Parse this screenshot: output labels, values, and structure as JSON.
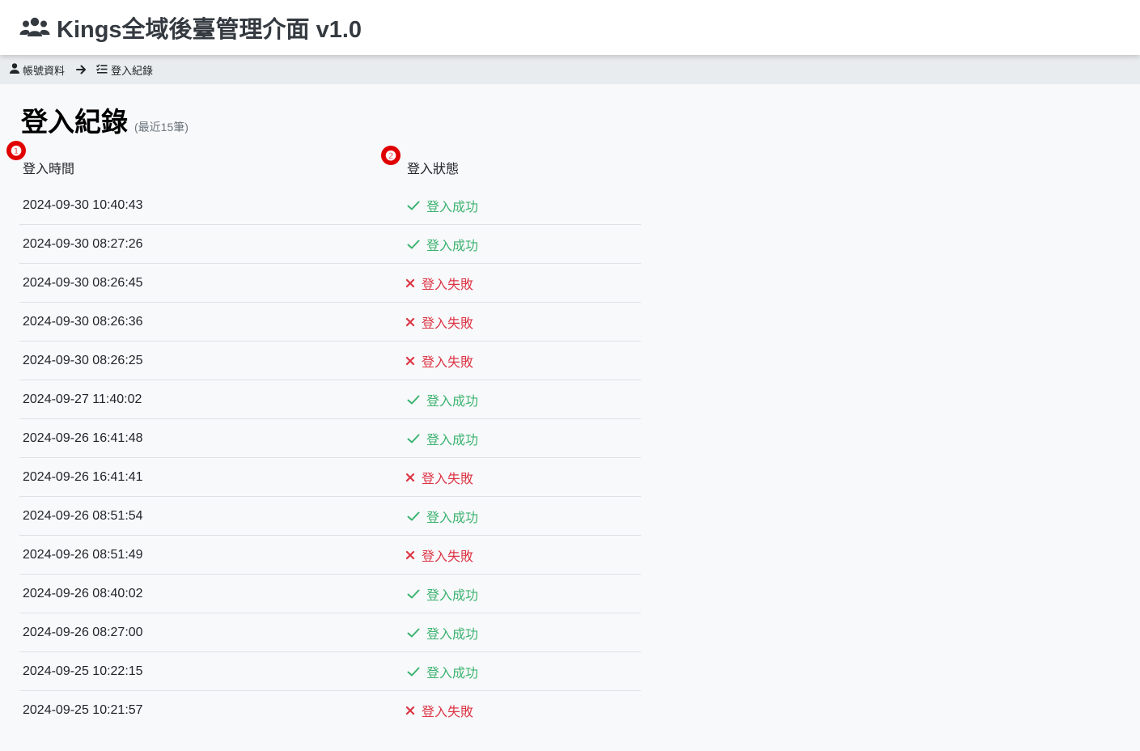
{
  "app": {
    "title": "Kings全域後臺管理介面 v1.0",
    "icon": "users-icon"
  },
  "breadcrumb": {
    "items": [
      {
        "label": "帳號資料",
        "icon": "user-icon"
      },
      {
        "label": "登入紀錄",
        "icon": "list-check-icon"
      }
    ],
    "separator_icon": "arrow-right-icon"
  },
  "page": {
    "title": "登入紀錄",
    "subtitle": "(最近15筆)"
  },
  "annotations": [
    "❶",
    "❷"
  ],
  "colors": {
    "success": "#3cb371",
    "failure": "#dc3545"
  },
  "table": {
    "columns": [
      "登入時間",
      "登入狀態"
    ],
    "rows": [
      {
        "time": "2024-09-30 10:40:43",
        "status": "登入成功",
        "ok": true
      },
      {
        "time": "2024-09-30 08:27:26",
        "status": "登入成功",
        "ok": true
      },
      {
        "time": "2024-09-30 08:26:45",
        "status": "登入失敗",
        "ok": false
      },
      {
        "time": "2024-09-30 08:26:36",
        "status": "登入失敗",
        "ok": false
      },
      {
        "time": "2024-09-30 08:26:25",
        "status": "登入失敗",
        "ok": false
      },
      {
        "time": "2024-09-27 11:40:02",
        "status": "登入成功",
        "ok": true
      },
      {
        "time": "2024-09-26 16:41:48",
        "status": "登入成功",
        "ok": true
      },
      {
        "time": "2024-09-26 16:41:41",
        "status": "登入失敗",
        "ok": false
      },
      {
        "time": "2024-09-26 08:51:54",
        "status": "登入成功",
        "ok": true
      },
      {
        "time": "2024-09-26 08:51:49",
        "status": "登入失敗",
        "ok": false
      },
      {
        "time": "2024-09-26 08:40:02",
        "status": "登入成功",
        "ok": true
      },
      {
        "time": "2024-09-26 08:27:00",
        "status": "登入成功",
        "ok": true
      },
      {
        "time": "2024-09-25 10:22:15",
        "status": "登入成功",
        "ok": true
      },
      {
        "time": "2024-09-25 10:21:57",
        "status": "登入失敗",
        "ok": false
      }
    ]
  }
}
